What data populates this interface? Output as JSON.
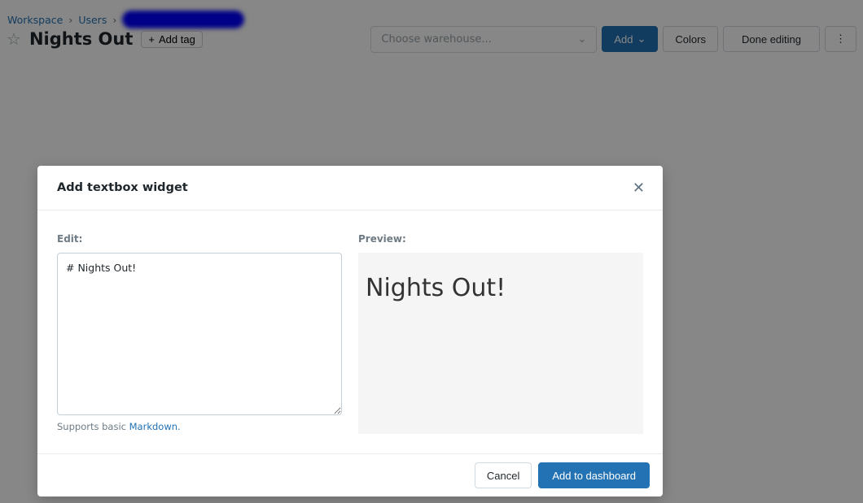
{
  "breadcrumb": {
    "items": [
      "Workspace",
      "Users"
    ]
  },
  "header": {
    "title": "Nights Out",
    "add_tag": "Add tag"
  },
  "toolbar": {
    "warehouse_placeholder": "Choose warehouse...",
    "add": "Add",
    "colors": "Colors",
    "done_editing": "Done editing"
  },
  "modal": {
    "title": "Add textbox widget",
    "edit_label": "Edit:",
    "preview_label": "Preview:",
    "editor_value": "# Nights Out!",
    "hint_prefix": "Supports basic ",
    "hint_link": "Markdown.",
    "preview_heading": "Nights Out!",
    "cancel": "Cancel",
    "submit": "Add to dashboard"
  },
  "colors": {
    "accent": "#2272b4",
    "preview_bg": "#f5f5f5"
  }
}
